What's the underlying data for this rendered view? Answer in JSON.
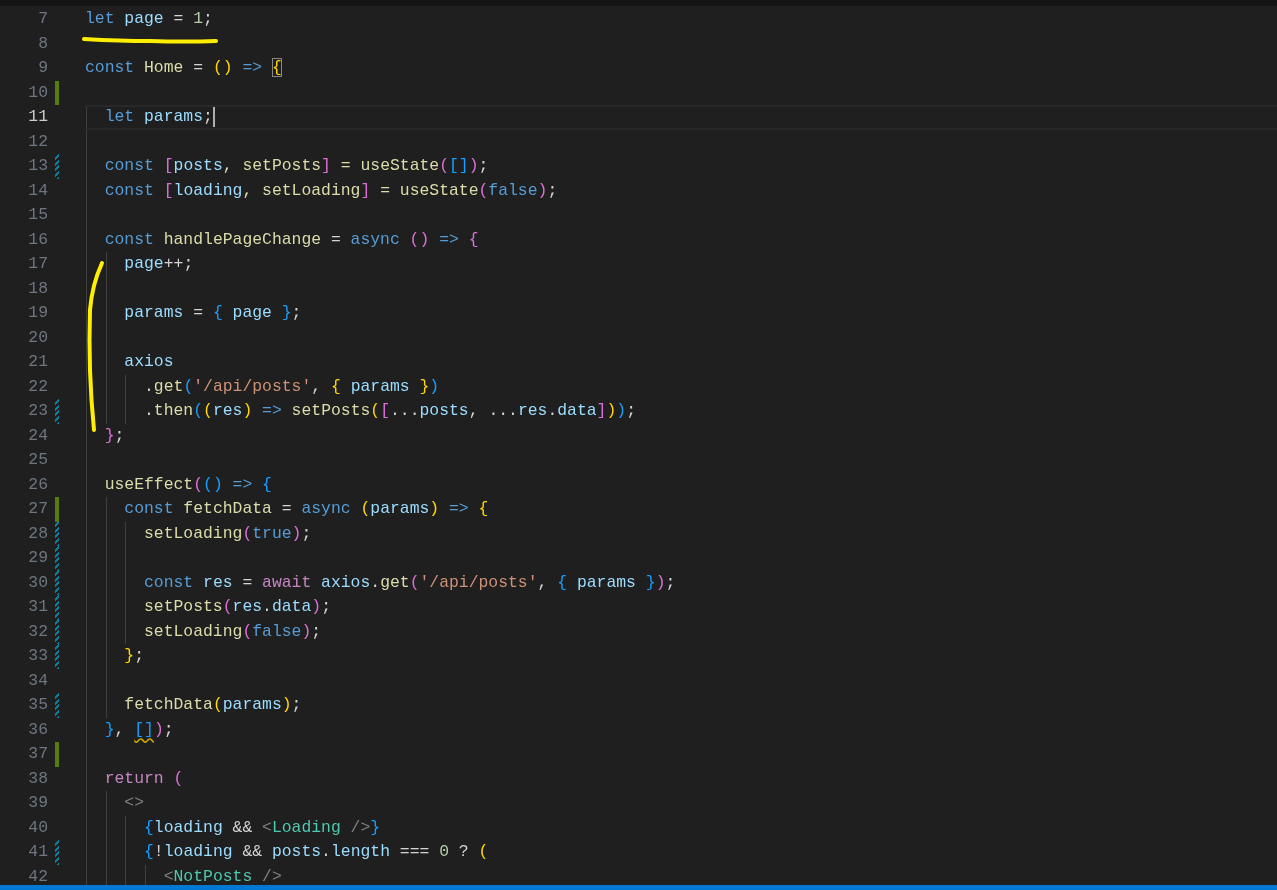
{
  "editor": {
    "lines": [
      {
        "number": "7",
        "tokens": [
          {
            "text": "let",
            "kind": "kw"
          },
          {
            "text": " page",
            "kind": "var"
          },
          {
            "text": " = ",
            "kind": "p"
          },
          {
            "text": "1",
            "kind": "num"
          },
          {
            "text": ";",
            "kind": "p"
          }
        ]
      },
      {
        "number": "8"
      },
      {
        "number": "9",
        "tokens": [
          {
            "text": "const",
            "kind": "kw"
          },
          {
            "text": " Home",
            "kind": "fn"
          },
          {
            "text": " = ",
            "kind": "p"
          },
          {
            "text": "()",
            "kind": "b1"
          },
          {
            "text": " => ",
            "kind": "kw"
          },
          {
            "text": "{",
            "kind": "bracket_match"
          }
        ]
      },
      {
        "number": "10",
        "added": true
      },
      {
        "number": "11",
        "current": true,
        "tokens": [
          {
            "text": "  let",
            "kind": "kw"
          },
          {
            "text": " params",
            "kind": "var"
          },
          {
            "text": ";",
            "kind": "p"
          }
        ]
      },
      {
        "number": "12"
      },
      {
        "number": "13",
        "modified": true,
        "tokens": [
          {
            "text": "  const",
            "kind": "kw"
          },
          {
            "text": " [",
            "kind": "b2"
          },
          {
            "text": "posts",
            "kind": "var"
          },
          {
            "text": ", setPosts",
            "kind": "fn"
          },
          {
            "text": "]",
            "kind": "b2"
          },
          {
            "text": " = useState",
            "kind": "fn"
          },
          {
            "text": "(",
            "kind": "b2"
          },
          {
            "text": "[]",
            "kind": "b3"
          },
          {
            "text": ")",
            "kind": "b2"
          },
          {
            "text": ";",
            "kind": "p"
          }
        ]
      },
      {
        "number": "14",
        "tokens": [
          {
            "text": "  const",
            "kind": "kw"
          },
          {
            "text": " [",
            "kind": "b2"
          },
          {
            "text": "loading",
            "kind": "var"
          },
          {
            "text": ", setLoading",
            "kind": "fn"
          },
          {
            "text": "]",
            "kind": "b2"
          },
          {
            "text": " = useState",
            "kind": "fn"
          },
          {
            "text": "(",
            "kind": "b2"
          },
          {
            "text": "false",
            "kind": "kw"
          },
          {
            "text": ")",
            "kind": "b2"
          },
          {
            "text": ";",
            "kind": "p"
          }
        ]
      },
      {
        "number": "15"
      },
      {
        "number": "16",
        "tokens": [
          {
            "text": "  const",
            "kind": "kw"
          },
          {
            "text": " handlePageChange",
            "kind": "fn"
          },
          {
            "text": " = ",
            "kind": "p"
          },
          {
            "text": "async",
            "kind": "kw"
          },
          {
            "text": " ()",
            "kind": "b2"
          },
          {
            "text": " =>",
            "kind": "kw"
          },
          {
            "text": " {",
            "kind": "b2"
          }
        ]
      },
      {
        "number": "17",
        "tokens": [
          {
            "text": "    page",
            "kind": "var"
          },
          {
            "text": "++;",
            "kind": "p"
          }
        ]
      },
      {
        "number": "18"
      },
      {
        "number": "19",
        "tokens": [
          {
            "text": "    params",
            "kind": "var"
          },
          {
            "text": " = ",
            "kind": "p"
          },
          {
            "text": "{",
            "kind": "b3"
          },
          {
            "text": " page ",
            "kind": "var"
          },
          {
            "text": "}",
            "kind": "b3"
          },
          {
            "text": ";",
            "kind": "p"
          }
        ]
      },
      {
        "number": "20"
      },
      {
        "number": "21",
        "tokens": [
          {
            "text": "    axios",
            "kind": "var"
          }
        ]
      },
      {
        "number": "22",
        "tokens": [
          {
            "text": "      .",
            "kind": "p"
          },
          {
            "text": "get",
            "kind": "fn"
          },
          {
            "text": "(",
            "kind": "b3"
          },
          {
            "text": "'/api/posts'",
            "kind": "str"
          },
          {
            "text": ", ",
            "kind": "p"
          },
          {
            "text": "{",
            "kind": "b1"
          },
          {
            "text": " params ",
            "kind": "var"
          },
          {
            "text": "}",
            "kind": "b1"
          },
          {
            "text": ")",
            "kind": "b3"
          }
        ]
      },
      {
        "number": "23",
        "modified": true,
        "tokens": [
          {
            "text": "      .",
            "kind": "p"
          },
          {
            "text": "then",
            "kind": "fn"
          },
          {
            "text": "(",
            "kind": "b3"
          },
          {
            "text": "(",
            "kind": "b1"
          },
          {
            "text": "res",
            "kind": "var"
          },
          {
            "text": ")",
            "kind": "b1"
          },
          {
            "text": " =>",
            "kind": "kw"
          },
          {
            "text": " setPosts",
            "kind": "fn"
          },
          {
            "text": "(",
            "kind": "b1"
          },
          {
            "text": "[",
            "kind": "b2"
          },
          {
            "text": "...",
            "kind": "p"
          },
          {
            "text": "posts",
            "kind": "var"
          },
          {
            "text": ", ...",
            "kind": "p"
          },
          {
            "text": "res",
            "kind": "var"
          },
          {
            "text": ".",
            "kind": "p"
          },
          {
            "text": "data",
            "kind": "var"
          },
          {
            "text": "]",
            "kind": "b2"
          },
          {
            "text": ")",
            "kind": "b1"
          },
          {
            "text": ")",
            "kind": "b3"
          },
          {
            "text": ";",
            "kind": "p"
          }
        ]
      },
      {
        "number": "24",
        "tokens": [
          {
            "text": "  }",
            "kind": "b2"
          },
          {
            "text": ";",
            "kind": "p"
          }
        ]
      },
      {
        "number": "25"
      },
      {
        "number": "26",
        "tokens": [
          {
            "text": "  useEffect",
            "kind": "fn"
          },
          {
            "text": "(",
            "kind": "b2"
          },
          {
            "text": "()",
            "kind": "b3"
          },
          {
            "text": " =>",
            "kind": "kw"
          },
          {
            "text": " {",
            "kind": "b3"
          }
        ]
      },
      {
        "number": "27",
        "added": true,
        "tokens": [
          {
            "text": "    const",
            "kind": "kw"
          },
          {
            "text": " fetchData",
            "kind": "fn"
          },
          {
            "text": " = ",
            "kind": "p"
          },
          {
            "text": "async",
            "kind": "kw"
          },
          {
            "text": " (",
            "kind": "b1"
          },
          {
            "text": "params",
            "kind": "var"
          },
          {
            "text": ")",
            "kind": "b1"
          },
          {
            "text": " =>",
            "kind": "kw"
          },
          {
            "text": " {",
            "kind": "b1"
          }
        ]
      },
      {
        "number": "28",
        "modified": true,
        "tokens": [
          {
            "text": "      setLoading",
            "kind": "fn"
          },
          {
            "text": "(",
            "kind": "b2"
          },
          {
            "text": "true",
            "kind": "kw"
          },
          {
            "text": ")",
            "kind": "b2"
          },
          {
            "text": ";",
            "kind": "p"
          }
        ]
      },
      {
        "number": "29",
        "modified": true
      },
      {
        "number": "30",
        "modified": true,
        "tokens": [
          {
            "text": "      const",
            "kind": "kw"
          },
          {
            "text": " res",
            "kind": "var"
          },
          {
            "text": " = ",
            "kind": "p"
          },
          {
            "text": "await",
            "kind": "ctl"
          },
          {
            "text": " axios",
            "kind": "var"
          },
          {
            "text": ".",
            "kind": "p"
          },
          {
            "text": "get",
            "kind": "fn"
          },
          {
            "text": "(",
            "kind": "b2"
          },
          {
            "text": "'/api/posts'",
            "kind": "str"
          },
          {
            "text": ", ",
            "kind": "p"
          },
          {
            "text": "{",
            "kind": "b3"
          },
          {
            "text": " params ",
            "kind": "var"
          },
          {
            "text": "}",
            "kind": "b3"
          },
          {
            "text": ")",
            "kind": "b2"
          },
          {
            "text": ";",
            "kind": "p"
          }
        ]
      },
      {
        "number": "31",
        "modified": true,
        "tokens": [
          {
            "text": "      setPosts",
            "kind": "fn"
          },
          {
            "text": "(",
            "kind": "b2"
          },
          {
            "text": "res",
            "kind": "var"
          },
          {
            "text": ".",
            "kind": "p"
          },
          {
            "text": "data",
            "kind": "var"
          },
          {
            "text": ")",
            "kind": "b2"
          },
          {
            "text": ";",
            "kind": "p"
          }
        ]
      },
      {
        "number": "32",
        "modified": true,
        "tokens": [
          {
            "text": "      setLoading",
            "kind": "fn"
          },
          {
            "text": "(",
            "kind": "b2"
          },
          {
            "text": "false",
            "kind": "kw"
          },
          {
            "text": ")",
            "kind": "b2"
          },
          {
            "text": ";",
            "kind": "p"
          }
        ]
      },
      {
        "number": "33",
        "modified": true,
        "tokens": [
          {
            "text": "    }",
            "kind": "b1"
          },
          {
            "text": ";",
            "kind": "p"
          }
        ]
      },
      {
        "number": "34"
      },
      {
        "number": "35",
        "modified": true,
        "tokens": [
          {
            "text": "    fetchData",
            "kind": "fn"
          },
          {
            "text": "(",
            "kind": "b1"
          },
          {
            "text": "params",
            "kind": "var"
          },
          {
            "text": ")",
            "kind": "b1"
          },
          {
            "text": ";",
            "kind": "p"
          }
        ]
      },
      {
        "number": "36",
        "tokens": [
          {
            "text": "  }",
            "kind": "b3"
          },
          {
            "text": ", ",
            "kind": "p"
          },
          {
            "text": "[]",
            "kind": "warning"
          },
          {
            "text": ")",
            "kind": "b2"
          },
          {
            "text": ";",
            "kind": "p"
          }
        ]
      },
      {
        "number": "37",
        "added": true
      },
      {
        "number": "38",
        "tokens": [
          {
            "text": "  return",
            "kind": "ctl"
          },
          {
            "text": " (",
            "kind": "b2"
          }
        ]
      },
      {
        "number": "39",
        "tokens": [
          {
            "text": "    <>",
            "kind": "tag"
          }
        ]
      },
      {
        "number": "40",
        "tokens": [
          {
            "text": "      {",
            "kind": "b3"
          },
          {
            "text": "loading",
            "kind": "var"
          },
          {
            "text": " && ",
            "kind": "p"
          },
          {
            "text": "<",
            "kind": "tag"
          },
          {
            "text": "Loading",
            "kind": "comp"
          },
          {
            "text": " />",
            "kind": "tag"
          },
          {
            "text": "}",
            "kind": "b3"
          }
        ]
      },
      {
        "number": "41",
        "modified": true,
        "tokens": [
          {
            "text": "      {",
            "kind": "b3"
          },
          {
            "text": "!",
            "kind": "p"
          },
          {
            "text": "loading",
            "kind": "var"
          },
          {
            "text": " && ",
            "kind": "p"
          },
          {
            "text": "posts",
            "kind": "var"
          },
          {
            "text": ".",
            "kind": "p"
          },
          {
            "text": "length",
            "kind": "var"
          },
          {
            "text": " === ",
            "kind": "p"
          },
          {
            "text": "0",
            "kind": "num"
          },
          {
            "text": " ? ",
            "kind": "p"
          },
          {
            "text": "(",
            "kind": "b1"
          }
        ]
      },
      {
        "number": "42",
        "tokens": [
          {
            "text": "        <",
            "kind": "tag"
          },
          {
            "text": "NotPosts",
            "kind": "comp"
          },
          {
            "text": " />",
            "kind": "tag"
          }
        ]
      }
    ]
  }
}
